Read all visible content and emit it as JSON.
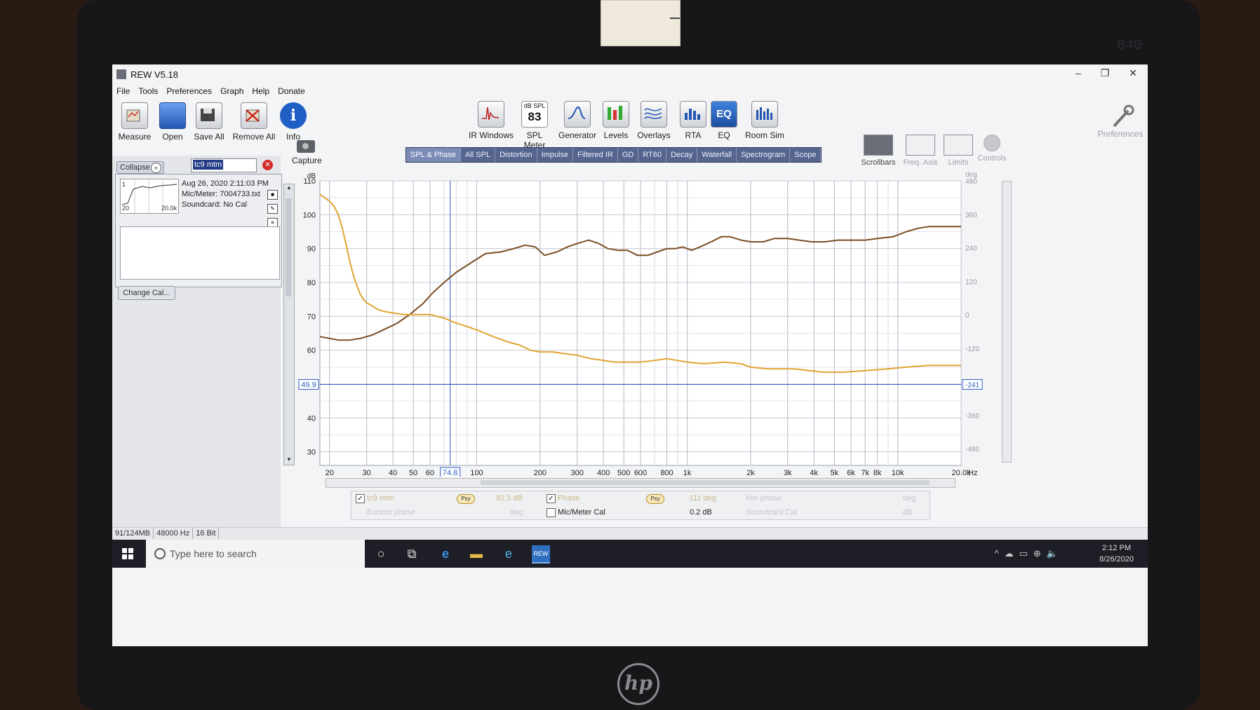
{
  "window": {
    "title": "REW V5.18",
    "min": "–",
    "max": "❐",
    "close": "✕"
  },
  "menu": [
    "File",
    "Tools",
    "Preferences",
    "Graph",
    "Help",
    "Donate"
  ],
  "toolbar": {
    "left": [
      "Measure",
      "Open",
      "Save All",
      "Remove All",
      "Info"
    ],
    "center": [
      "IR Windows",
      "SPL Meter",
      "Generator",
      "Levels",
      "Overlays",
      "RTA",
      "EQ",
      "Room Sim"
    ],
    "spl_small": "dB SPL",
    "spl_value": "83",
    "eq_text": "EQ",
    "info_glyph": "i",
    "preferences": "Preferences"
  },
  "panel": {
    "collapse": "Collapse",
    "measurement_name": "tc9 mtm",
    "date": "Aug 26, 2020 2:11:03 PM",
    "mic_meter": "Mic/Meter: 7004733.txt",
    "soundcard": "Soundcard: No Cal",
    "thumb_left": "20",
    "thumb_right": "20.0k",
    "thumb_top": "1",
    "change_cal": "Change Cal..."
  },
  "capture": "Capture",
  "tabs": [
    "SPL & Phase",
    "All SPL",
    "Distortion",
    "Impulse",
    "Filtered IR",
    "GD",
    "RT60",
    "Decay",
    "Waterfall",
    "Spectrogram",
    "Scope"
  ],
  "active_tab": "SPL & Phase",
  "right_tools": [
    "Scrollbars",
    "Freq. Axis",
    "Limits",
    "Controls"
  ],
  "chart_data": {
    "type": "line",
    "ylabel": "dB",
    "y2label": "deg",
    "xunit": "Hz",
    "xlim": [
      18,
      20000
    ],
    "x_scale": "log",
    "ylim": [
      26,
      110
    ],
    "y2lim": [
      -540,
      480
    ],
    "grid": true,
    "x_ticks": [
      "20",
      "30",
      "40",
      "50",
      "60",
      "100",
      "200",
      "300",
      "400",
      "500",
      "600",
      "800",
      "1k",
      "2k",
      "3k",
      "4k",
      "5k",
      "6k",
      "7k",
      "8k",
      "10k",
      "20.0k"
    ],
    "x_tick_values": [
      20,
      30,
      40,
      50,
      60,
      100,
      200,
      300,
      400,
      500,
      600,
      800,
      1000,
      2000,
      3000,
      4000,
      5000,
      6000,
      7000,
      8000,
      10000,
      20000
    ],
    "y_ticks": [
      "110",
      "100",
      "90",
      "80",
      "70",
      "60",
      "40",
      "30"
    ],
    "y_tick_values": [
      110,
      100,
      90,
      80,
      70,
      60,
      40,
      30
    ],
    "y2_ticks": [
      "480",
      "360",
      "240",
      "120",
      "0",
      "-120",
      "-360",
      "-480"
    ],
    "y2_tick_values": [
      480,
      360,
      240,
      120,
      0,
      -120,
      -360,
      -480
    ],
    "cursor": {
      "x": 74.8,
      "x_label": "74.8",
      "y": 49.9,
      "y_label": "49.9",
      "y2_label": "-241"
    },
    "series": [
      {
        "color": "#7a4e22",
        "x": [
          18,
          20,
          22,
          25,
          28,
          32,
          36,
          42,
          48,
          55,
          62,
          70,
          80,
          95,
          110,
          130,
          150,
          170,
          190,
          210,
          240,
          270,
          300,
          340,
          380,
          420,
          470,
          520,
          580,
          650,
          720,
          800,
          880,
          950,
          1050,
          1150,
          1300,
          1450,
          1600,
          1800,
          2000,
          2300,
          2600,
          3000,
          3400,
          3900,
          4500,
          5200,
          6000,
          7000,
          8000,
          9500,
          11000,
          12500,
          14000,
          16000,
          20000
        ],
        "y": [
          64,
          63.5,
          63,
          63,
          63.5,
          64.5,
          66,
          68,
          70.5,
          73.5,
          77,
          80,
          83,
          86,
          88.5,
          89,
          90,
          91,
          90.5,
          88,
          89,
          90.5,
          91.5,
          92.5,
          91.5,
          90,
          89.5,
          89.5,
          88,
          88,
          89,
          90,
          90,
          90.5,
          89.5,
          90.5,
          92,
          93.5,
          93.5,
          92.5,
          92,
          92,
          93,
          93,
          92.5,
          92,
          92,
          92.5,
          92.5,
          92.5,
          93,
          93.5,
          95,
          96,
          96.5,
          96.5,
          96.5
        ]
      },
      {
        "color": "#e0a434",
        "x": [
          18,
          19,
          20,
          21,
          22,
          23,
          24,
          25,
          26,
          27,
          28,
          29,
          30,
          32,
          34,
          36,
          40,
          45,
          50,
          55,
          60,
          70,
          80,
          90,
          100,
          120,
          140,
          160,
          180,
          200,
          230,
          260,
          300,
          350,
          400,
          450,
          500,
          600,
          700,
          800,
          1000,
          1200,
          1500,
          1800,
          2000,
          2400,
          2800,
          3200,
          3800,
          4500,
          5500,
          7000,
          9000,
          11000,
          14000,
          17000,
          20000
        ],
        "y": [
          106,
          105,
          104,
          102.5,
          100,
          96,
          91,
          86,
          82,
          79,
          76.5,
          75,
          74,
          73,
          72,
          71.5,
          71,
          70.5,
          70.5,
          70.5,
          70.5,
          69.5,
          68,
          67,
          66,
          64,
          62.5,
          61.5,
          60,
          59.5,
          59.5,
          59,
          58.5,
          57.5,
          57,
          56.5,
          56.5,
          56.5,
          57,
          57.5,
          56.5,
          56,
          56.5,
          56,
          55,
          54.5,
          54.5,
          54.5,
          54,
          53.5,
          53.5,
          54,
          54.5,
          55,
          55.5,
          55.5,
          55.5
        ]
      }
    ]
  },
  "legend": {
    "name": "tc9 mtm",
    "psy1": "Psy",
    "val1": "82.5 dB",
    "phase": "Phase",
    "psy2": "Psy",
    "val2": "-111 deg",
    "min_phase": "Min phase",
    "min_phase_unit": "deg",
    "excess_phase": "Excess phase",
    "excess_unit": "deg",
    "mic_cal": "Mic/Meter Cal",
    "mic_cal_val": "0.2 dB",
    "soundcard_cal": "Soundcard Cal",
    "soundcard_unit": "dB",
    "check": "✓"
  },
  "status": {
    "memory": "91/124MB",
    "rate": "48000 Hz",
    "bits": "16 Bit"
  },
  "taskbar": {
    "search_placeholder": "Type here to search",
    "time": "2:12 PM",
    "date": "8/26/2020",
    "rew_label": "REW"
  }
}
